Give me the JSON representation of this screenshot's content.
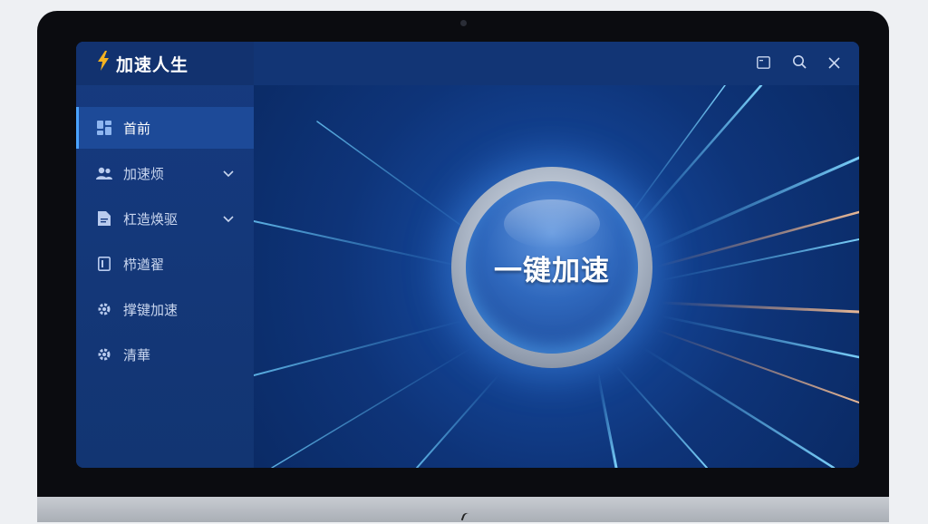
{
  "app": {
    "brand_name": "加速人生",
    "brand_icon": "lightning-bolt-icon"
  },
  "sidebar": {
    "items": [
      {
        "label": "首前",
        "icon": "grid-icon",
        "active": true,
        "expandable": false
      },
      {
        "label": "加速烦",
        "icon": "users-icon",
        "active": false,
        "expandable": true
      },
      {
        "label": "杠造焕驱",
        "icon": "document-icon",
        "active": false,
        "expandable": true
      },
      {
        "label": "栉遒翟",
        "icon": "file-icon",
        "active": false,
        "expandable": false
      },
      {
        "label": "撑键加速",
        "icon": "gear-icon",
        "active": false,
        "expandable": false
      },
      {
        "label": "清華",
        "icon": "gear-icon",
        "active": false,
        "expandable": false
      }
    ]
  },
  "window_controls": [
    "window-icon",
    "search-icon",
    "close-icon"
  ],
  "main": {
    "boost_button_label": "一键加速"
  },
  "colors": {
    "accent": "#4aa3ff",
    "bolt": "#f5b321",
    "sidebar_bg": "#163a80",
    "main_bg": "#0e3479"
  }
}
